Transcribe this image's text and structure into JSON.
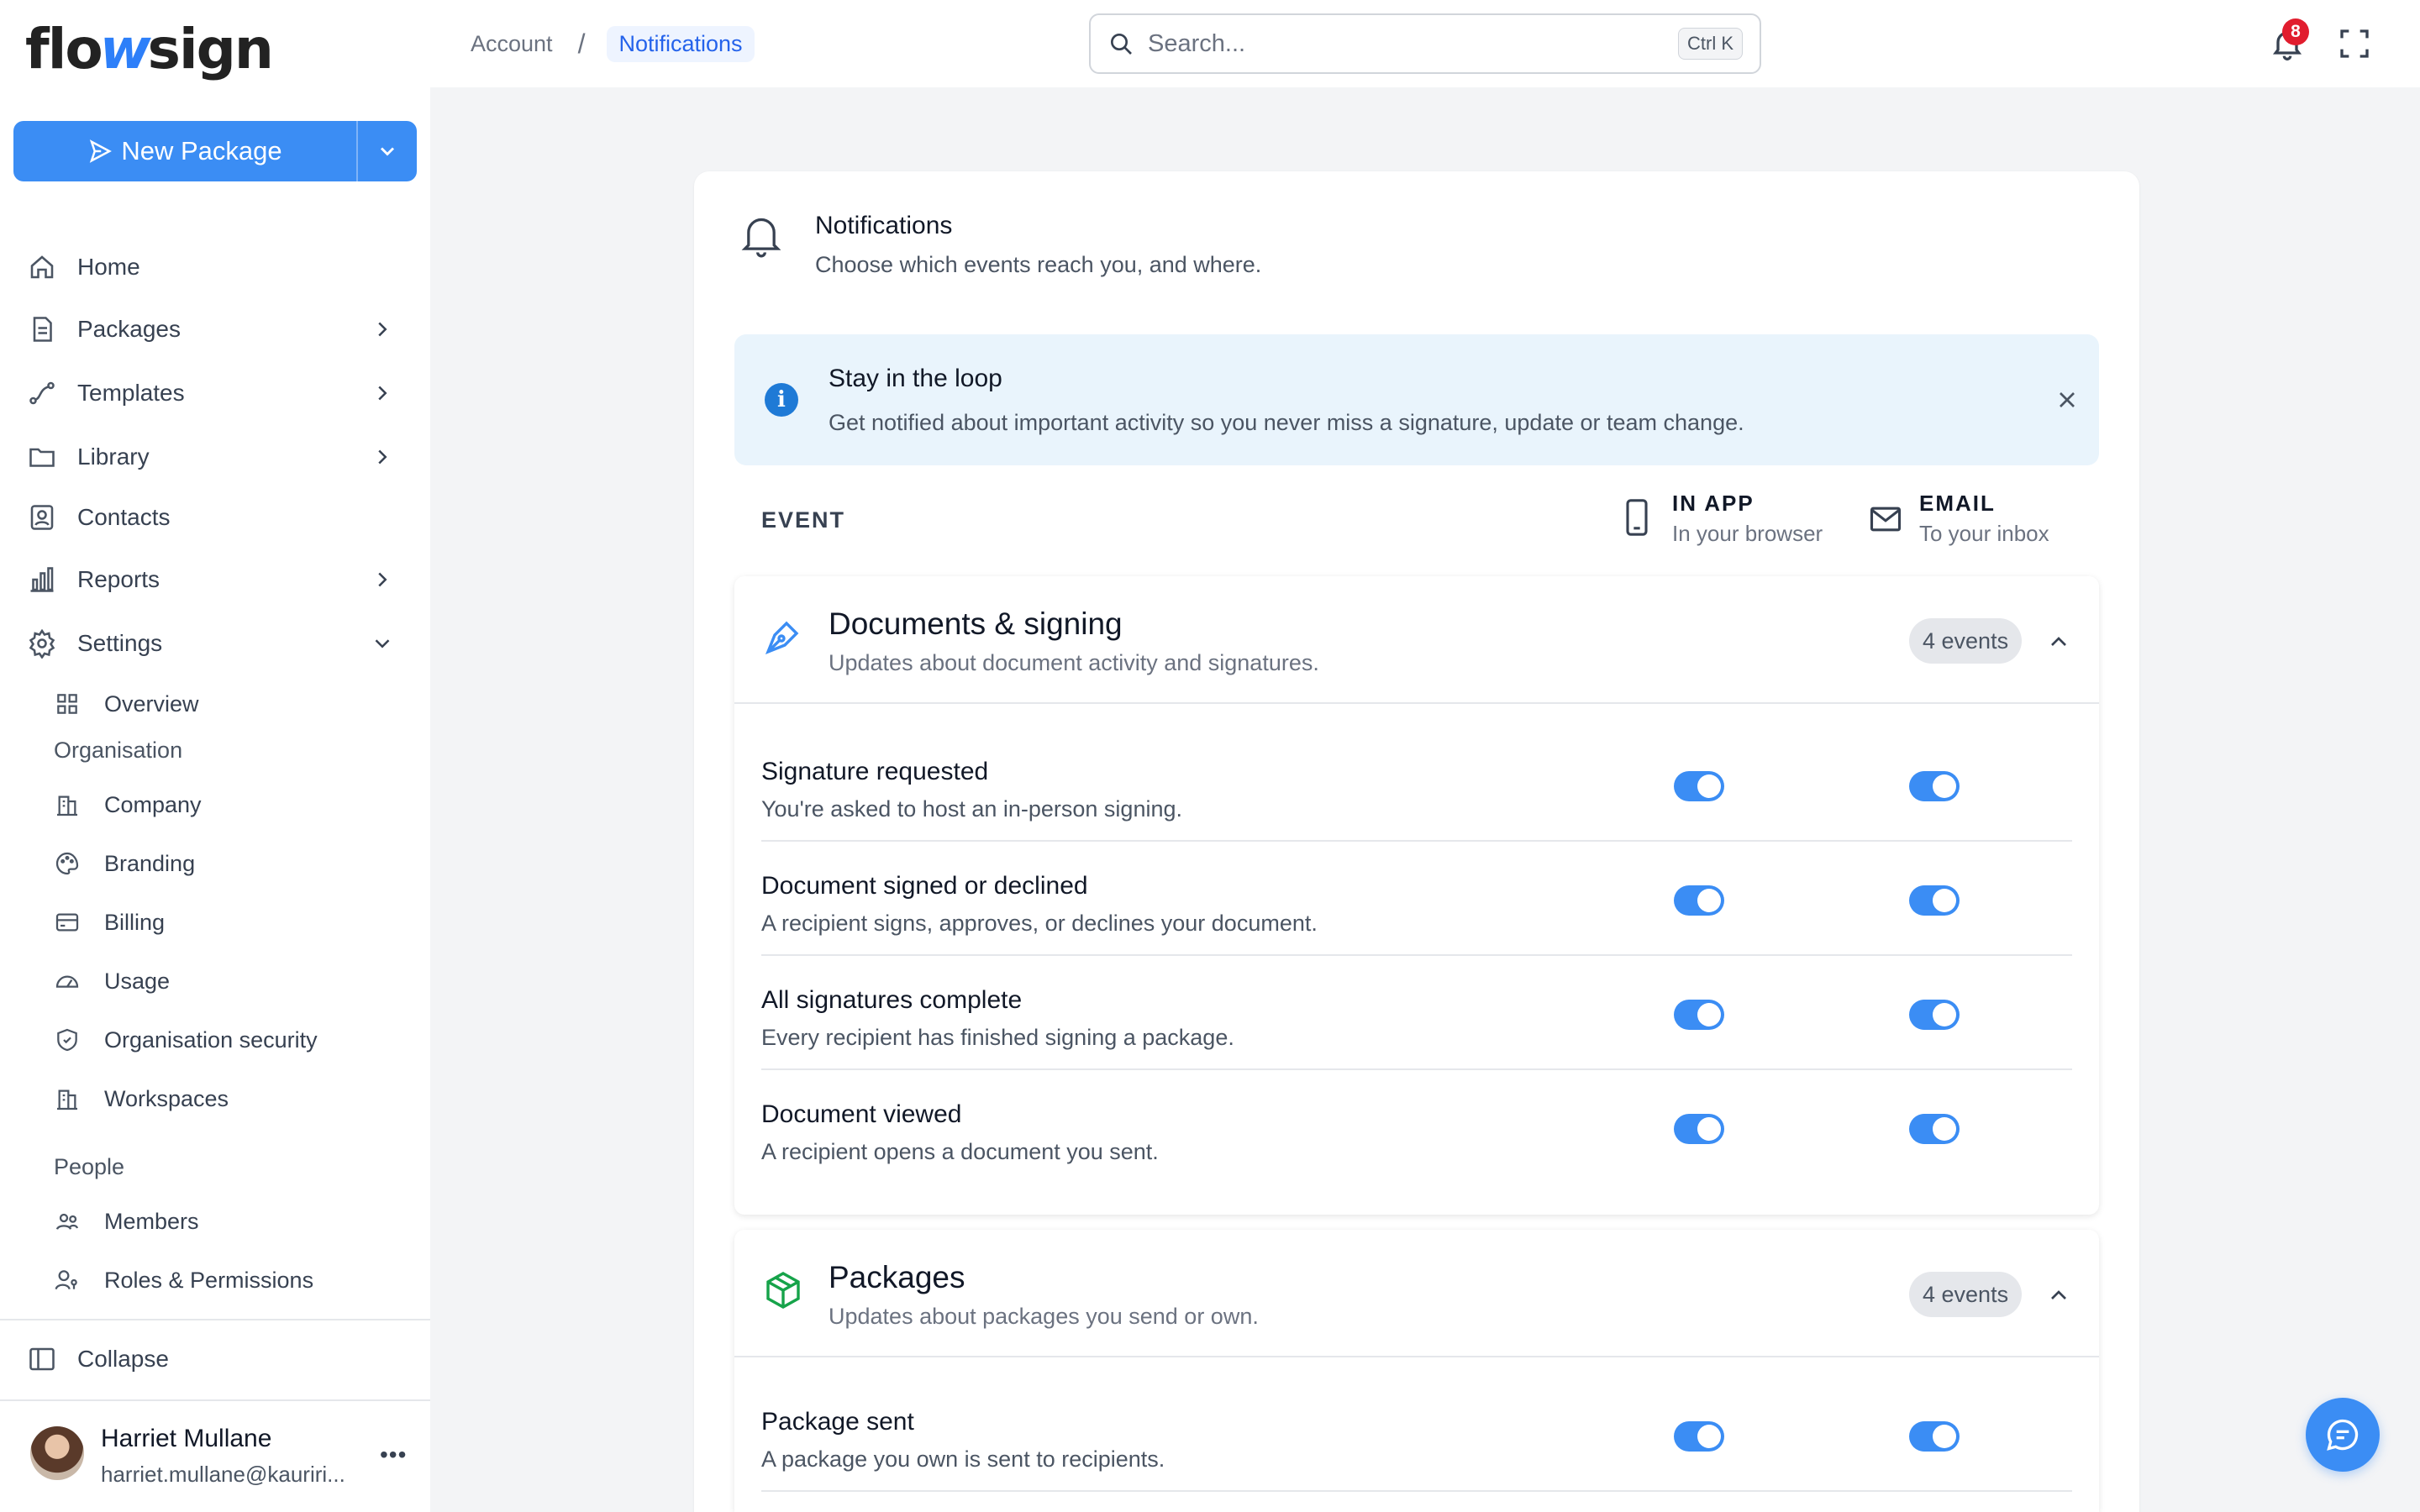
{
  "app": {
    "logo_left": "flo",
    "logo_mid": "w",
    "logo_right": "sign"
  },
  "breadcrumb": {
    "parent": "Account",
    "separator": "/",
    "current": "Notifications"
  },
  "search": {
    "placeholder": "Search...",
    "shortcut": "Ctrl K"
  },
  "topbar": {
    "notification_count": "8"
  },
  "sidebar": {
    "new_package": "New Package",
    "nav": [
      {
        "label": "Home",
        "icon": "home-icon"
      },
      {
        "label": "Packages",
        "icon": "document-icon"
      },
      {
        "label": "Templates",
        "icon": "route-icon"
      },
      {
        "label": "Library",
        "icon": "folder-icon"
      },
      {
        "label": "Contacts",
        "icon": "contacts-icon"
      },
      {
        "label": "Reports",
        "icon": "bar-chart-icon"
      },
      {
        "label": "Settings",
        "icon": "gear-icon"
      }
    ],
    "settings_overview": "Overview",
    "organisation_label": "Organisation",
    "organisation": [
      {
        "label": "Company",
        "icon": "building-icon"
      },
      {
        "label": "Branding",
        "icon": "palette-icon"
      },
      {
        "label": "Billing",
        "icon": "credit-card-icon"
      },
      {
        "label": "Usage",
        "icon": "gauge-icon"
      },
      {
        "label": "Organisation security",
        "icon": "shield-icon"
      },
      {
        "label": "Workspaces",
        "icon": "building-icon"
      }
    ],
    "people_label": "People",
    "people": [
      {
        "label": "Members",
        "icon": "users-icon"
      },
      {
        "label": "Roles & Permissions",
        "icon": "user-key-icon"
      }
    ],
    "collapse": "Collapse",
    "user": {
      "name": "Harriet Mullane",
      "email": "harriet.mullane@kauriri...",
      "more": "•••"
    }
  },
  "header": {
    "title": "Notifications",
    "subtitle": "Choose which events reach you, and where."
  },
  "banner": {
    "title": "Stay in the loop",
    "text": "Get notified about important activity so you never miss a signature, update or team change."
  },
  "columns": {
    "event": "EVENT",
    "in_app_title": "IN APP",
    "in_app_sub": "In your browser",
    "email_title": "EMAIL",
    "email_sub": "To your inbox"
  },
  "sections": [
    {
      "title": "Documents & signing",
      "subtitle": "Updates about document activity and signatures.",
      "badge": "4 events",
      "rows": [
        {
          "title": "Signature requested",
          "subtitle": "You're asked to host an in-person signing.",
          "in_app": true,
          "email": true
        },
        {
          "title": "Document signed or declined",
          "subtitle": "A recipient signs, approves, or declines your document.",
          "in_app": true,
          "email": true
        },
        {
          "title": "All signatures complete",
          "subtitle": "Every recipient has finished signing a package.",
          "in_app": true,
          "email": true
        },
        {
          "title": "Document viewed",
          "subtitle": "A recipient opens a document you sent.",
          "in_app": true,
          "email": true
        }
      ]
    },
    {
      "title": "Packages",
      "subtitle": "Updates about packages you send or own.",
      "badge": "4 events",
      "rows": [
        {
          "title": "Package sent",
          "subtitle": "A package you own is sent to recipients.",
          "in_app": true,
          "email": true
        }
      ]
    }
  ],
  "colors": {
    "accent": "#3b8df4",
    "banner_bg": "#e9f4fc",
    "badge_red": "#e11d2e",
    "package_green": "#16a34a"
  }
}
